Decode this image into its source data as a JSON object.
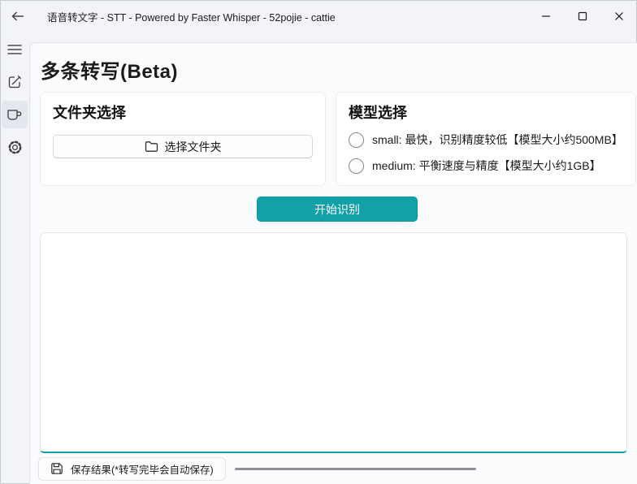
{
  "titlebar": {
    "title": "语音转文字 - STT - Powered by Faster Whisper - 52pojie - cattie",
    "icons": [
      "back-arrow-icon",
      "minimize-icon",
      "maximize-icon",
      "close-icon"
    ]
  },
  "sidebar": {
    "items": [
      {
        "name": "menu",
        "icon": "hamburger-menu-icon",
        "selected": false
      },
      {
        "name": "compose",
        "icon": "edit-compose-icon",
        "selected": false
      },
      {
        "name": "transcribe",
        "icon": "coffee-cup-icon",
        "selected": true
      },
      {
        "name": "settings",
        "icon": "gear-icon",
        "selected": false
      }
    ]
  },
  "main": {
    "heading": "多条转写(Beta)",
    "folder_section": {
      "title": "文件夹选择",
      "button_label": "选择文件夹",
      "button_icon": "folder-icon"
    },
    "model_section": {
      "title": "模型选择",
      "options": [
        {
          "label": "small: 最快，识别精度较低【模型大小约500MB】",
          "selected": false
        },
        {
          "label": "medium: 平衡速度与精度【模型大小约1GB】",
          "selected": false
        }
      ]
    },
    "start_button_label": "开始识别",
    "output_text": "",
    "save_button_label": "保存结果(*转写完毕会自动保存)",
    "save_button_icon": "floppy-save-icon",
    "progress": {
      "value_percent": 0
    }
  },
  "colors": {
    "accent_teal": "#12a1a8",
    "titlebar_bg": "#f2f4f8",
    "panel_bg": "#fafbfd",
    "card_bg": "#ffffff",
    "progress_track": "#8f9095"
  }
}
